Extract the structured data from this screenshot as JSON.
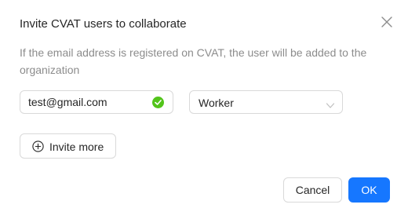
{
  "dialog": {
    "title": "Invite CVAT users to collaborate",
    "description": "If the email address is registered on CVAT, the user will be added to the organization"
  },
  "form": {
    "email_value": "test@gmail.com",
    "email_status_icon": "check-circle-icon",
    "role_value": "Worker",
    "role_icon": "chevron-down-icon",
    "invite_more_label": "Invite more",
    "invite_more_icon": "plus-circle-icon"
  },
  "footer": {
    "cancel_label": "Cancel",
    "ok_label": "OK"
  },
  "colors": {
    "primary": "#1677ff",
    "success": "#52c41a",
    "muted_text": "#8c8c8c",
    "border": "#d9d9d9"
  }
}
